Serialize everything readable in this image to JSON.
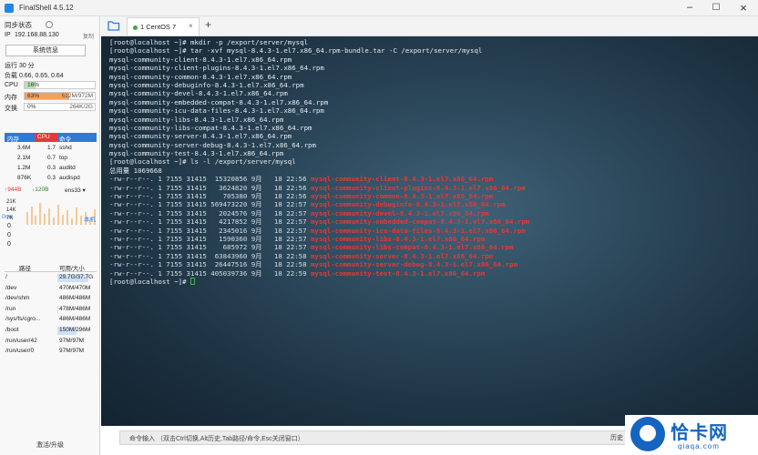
{
  "app": {
    "title": "FinalShell 4.5.12"
  },
  "left": {
    "sync_status": "同步状态",
    "ip_label": "IP",
    "ip": "192.168.88.130",
    "copy": "复制",
    "sysinfo_btn": "系统信息",
    "uptime": "运行 30 分",
    "load": "负载 0.66, 0.65, 0.64",
    "cpu": {
      "label": "CPU",
      "pct": "16%",
      "fraction": 0.16
    },
    "mem": {
      "label": "内存",
      "pct": "63%",
      "val": "612M/972M",
      "fraction": 0.63
    },
    "swap": {
      "label": "交换",
      "pct": "0%",
      "val": "264K/2G",
      "fraction": 0.0
    },
    "proc_headers": [
      "内存",
      "CPU",
      "命令"
    ],
    "processes": [
      {
        "mem": "3.6M",
        "cpu": "1.7",
        "cmd": "sshd"
      },
      {
        "mem": "2.1M",
        "cpu": "0.7",
        "cmd": "top"
      },
      {
        "mem": "1.2M",
        "cpu": "0.3",
        "cmd": "auditd"
      },
      {
        "mem": "876K",
        "cpu": "0.3",
        "cmd": "audispd"
      }
    ],
    "net": {
      "up": "↑944B",
      "down": "↓120B",
      "iface": "ens33",
      "scale": [
        "21K",
        "14K",
        "7K"
      ]
    },
    "latency": {
      "label": "0ms",
      "host": "本机",
      "values": [
        "0",
        "0",
        "0"
      ]
    },
    "disk_headers": [
      "路径",
      "可用/大小"
    ],
    "disks": [
      {
        "path": "/",
        "usage": "29.7G/37.7G",
        "fraction": 0.79
      },
      {
        "path": "/dev",
        "usage": "470M/470M",
        "fraction": 0.0
      },
      {
        "path": "/dev/shm",
        "usage": "486M/486M",
        "fraction": 0.0
      },
      {
        "path": "/run",
        "usage": "478M/486M",
        "fraction": 0.02
      },
      {
        "path": "/sys/fs/cgro...",
        "usage": "486M/486M",
        "fraction": 0.0
      },
      {
        "path": "/boot",
        "usage": "150M/296M",
        "fraction": 0.49
      },
      {
        "path": "/run/user/42",
        "usage": "97M/97M",
        "fraction": 0.0
      },
      {
        "path": "/run/user/0",
        "usage": "97M/97M",
        "fraction": 0.0
      }
    ],
    "upgrade": "激活/升级"
  },
  "tabs": [
    {
      "label": "1 CentOS 7"
    }
  ],
  "terminal": {
    "lines": [
      "[root@localhost ~]# mkdir -p /export/server/mysql",
      "[root@localhost ~]# tar -xvf mysql-8.4.3-1.el7.x86_64.rpm-bundle.tar -C /export/server/mysql",
      "mysql-community-client-8.4.3-1.el7.x86_64.rpm",
      "mysql-community-client-plugins-8.4.3-1.el7.x86_64.rpm",
      "mysql-community-common-8.4.3-1.el7.x86_64.rpm",
      "mysql-community-debuginfo-8.4.3-1.el7.x86_64.rpm",
      "mysql-community-devel-8.4.3-1.el7.x86_64.rpm",
      "mysql-community-embedded-compat-8.4.3-1.el7.x86_64.rpm",
      "mysql-community-icu-data-files-8.4.3-1.el7.x86_64.rpm",
      "mysql-community-libs-8.4.3-1.el7.x86_64.rpm",
      "mysql-community-libs-compat-8.4.3-1.el7.x86_64.rpm",
      "mysql-community-server-8.4.3-1.el7.x86_64.rpm",
      "mysql-community-server-debug-8.4.3-1.el7.x86_64.rpm",
      "mysql-community-test-8.4.3-1.el7.x86_64.rpm",
      "[root@localhost ~]# ls -l /export/server/mysql",
      "总用量 1069668"
    ],
    "ls_rows": [
      {
        "meta": "-rw-r--r--. 1 7155 31415  15320856 9月   18 22:56 ",
        "name": "mysql-community-client-8.4.3-1.el7.x86_64.rpm"
      },
      {
        "meta": "-rw-r--r--. 1 7155 31415   3624820 9月   18 22:56 ",
        "name": "mysql-community-client-plugins-8.4.3-1.el7.x86_64.rpm"
      },
      {
        "meta": "-rw-r--r--. 1 7155 31415    705380 9月   18 22:56 ",
        "name": "mysql-community-common-8.4.3-1.el7.x86_64.rpm"
      },
      {
        "meta": "-rw-r--r--. 1 7155 31415 569473220 9月   18 22:57 ",
        "name": "mysql-community-debuginfo-8.4.3-1.el7.x86_64.rpm"
      },
      {
        "meta": "-rw-r--r--. 1 7155 31415   2024576 9月   18 22:57 ",
        "name": "mysql-community-devel-8.4.3-1.el7.x86_64.rpm"
      },
      {
        "meta": "-rw-r--r--. 1 7155 31415   4217852 9月   18 22:57 ",
        "name": "mysql-community-embedded-compat-8.4.3-1.el7.x86_64.rpm"
      },
      {
        "meta": "-rw-r--r--. 1 7155 31415   2345016 9月   18 22:57 ",
        "name": "mysql-community-icu-data-files-8.4.3-1.el7.x86_64.rpm"
      },
      {
        "meta": "-rw-r--r--. 1 7155 31415   1590360 9月   18 22:57 ",
        "name": "mysql-community-libs-8.4.3-1.el7.x86_64.rpm"
      },
      {
        "meta": "-rw-r--r--. 1 7155 31415    685972 9月   18 22:57 ",
        "name": "mysql-community-libs-compat-8.4.3-1.el7.x86_64.rpm"
      },
      {
        "meta": "-rw-r--r--. 1 7155 31415  63843960 9月   18 22:58 ",
        "name": "mysql-community-server-8.4.3-1.el7.x86_64.rpm"
      },
      {
        "meta": "-rw-r--r--. 1 7155 31415  26447516 9月   18 22:58 ",
        "name": "mysql-community-server-debug-8.4.3-1.el7.x86_64.rpm"
      },
      {
        "meta": "-rw-r--r--. 1 7155 31415 405039736 9月   18 22:59 ",
        "name": "mysql-community-test-8.4.3-1.el7.x86_64.rpm"
      }
    ],
    "prompt": "[root@localhost ~]# "
  },
  "cmdbar": {
    "hint": "命令输入 （双击Ctrl切换,Alt历史,Tab路径/命令,Esc关闭窗口）",
    "history": "历史"
  },
  "watermark": {
    "text": "恰卡网",
    "domain": "qiaqa.com"
  },
  "colors": {
    "accent": "#2e7bd6",
    "file_red": "#e53935",
    "mem_fill": "#f2a15c",
    "cpu_fill": "#b7e4b0"
  }
}
